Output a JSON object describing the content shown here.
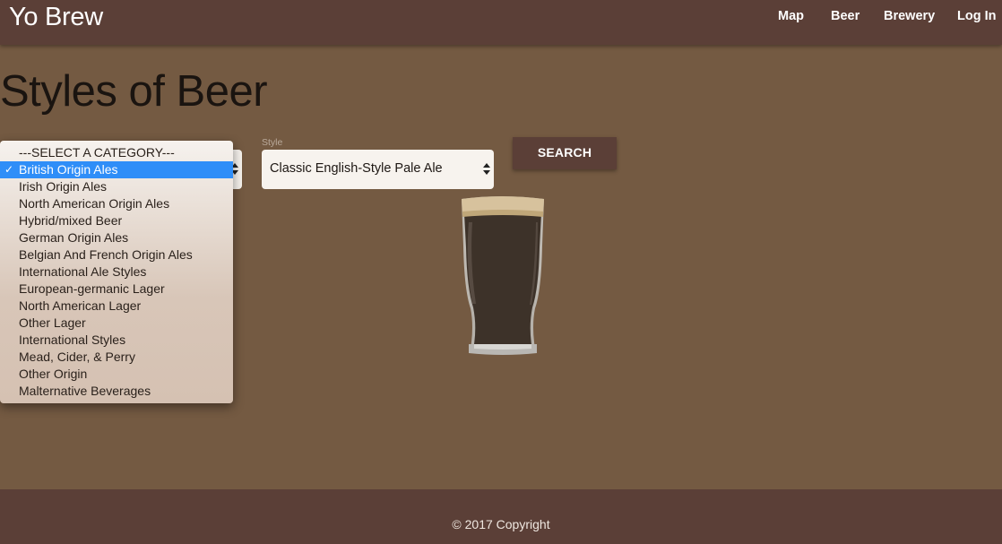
{
  "navbar": {
    "brand": "Yo Brew",
    "links": [
      "Map",
      "Beer",
      "Brewery",
      "Log In"
    ]
  },
  "main": {
    "title": "Styles of Beer",
    "category": {
      "selected_index": 1,
      "options": [
        "---SELECT A CATEGORY---",
        "British Origin Ales",
        "Irish Origin Ales",
        "North American Origin Ales",
        "Hybrid/mixed Beer",
        "German Origin Ales",
        "Belgian And French Origin Ales",
        "International Ale Styles",
        "European-germanic Lager",
        "North American Lager",
        "Other Lager",
        "International Styles",
        "Mead, Cider, & Perry",
        "Other Origin",
        "Malternative Beverages"
      ]
    },
    "style": {
      "label": "Style",
      "value": "Classic English-Style Pale Ale"
    },
    "search_label": "SEARCH",
    "check_glyph": "✓"
  },
  "footer": {
    "copyright": "© 2017 Copyright"
  },
  "colors": {
    "navbar": "#5b3f37",
    "page_background": "#745a42",
    "selected_option": "#2f8ef8"
  },
  "icons": {
    "beer": "pint-glass-icon"
  }
}
